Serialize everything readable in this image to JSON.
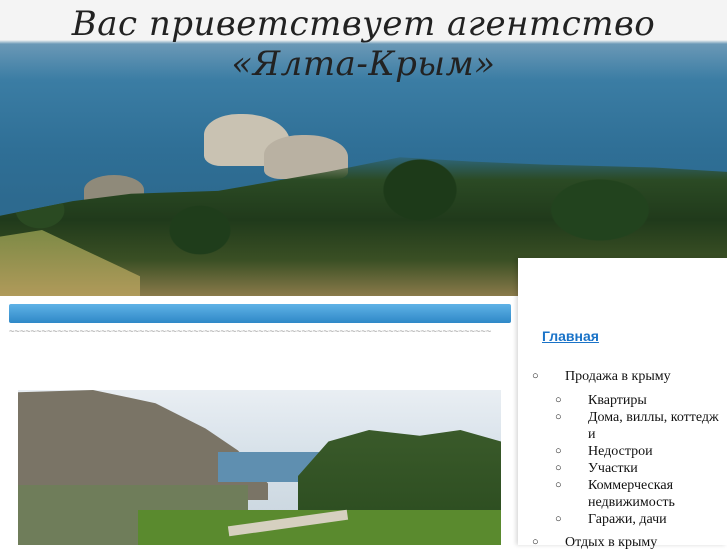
{
  "header": {
    "title": "Вас приветствует агентство «Ялта-Крым»"
  },
  "nav": {
    "home_label": "Главная",
    "items": [
      {
        "label": "Продажа в крыму",
        "children": [
          "Квартиры",
          "Дома, виллы, коттедж и",
          "Недострои",
          "Участки",
          "Коммерческая недвижимость",
          "Гаражи, дачи"
        ]
      },
      {
        "label": "Отдых в крыму"
      }
    ]
  },
  "content": {
    "divider": "~~~~~~~~~~~~~~~~~~~~~~~~~~~~~~~~~~~~~~~~~~~~~~~~~~~~~~~~~~~~~~~~~~~~~~~~~~~~~~~~~~~~~~~~~"
  },
  "colors": {
    "link": "#1a73c8",
    "bar_top": "#5fb2e6",
    "bar_bottom": "#2f88c7"
  }
}
